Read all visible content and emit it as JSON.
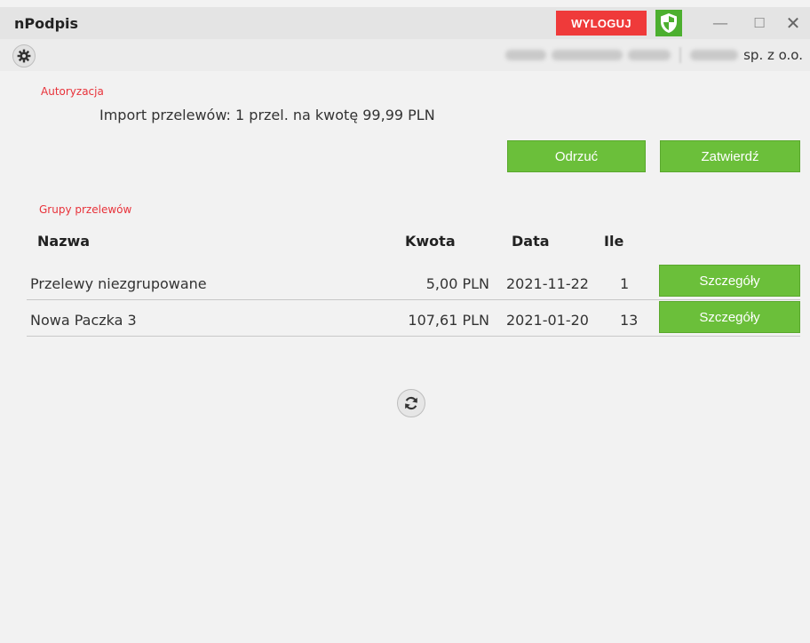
{
  "app": {
    "title": "nPodpis"
  },
  "titlebar": {
    "logout_label": "WYLOGUJ",
    "minimize_glyph": "—",
    "maximize_glyph": "☐",
    "close_glyph": "✕",
    "shield_icon": "shield-icon"
  },
  "toolbar": {
    "settings_icon": "gear-icon",
    "company_suffix": "sp. z o.o."
  },
  "authorization": {
    "section_label": "Autoryzacja",
    "import_text": "Import przelewów: 1 przel. na kwotę 99,99 PLN",
    "reject_label": "Odrzuć",
    "approve_label": "Zatwierdź"
  },
  "groups": {
    "section_label": "Grupy przelewów",
    "columns": {
      "name": "Nazwa",
      "amount": "Kwota",
      "date": "Data",
      "count": "Ile"
    },
    "rows": [
      {
        "name": "Przelewy niezgrupowane",
        "amount": "5,00 PLN",
        "date": "2021-11-22",
        "count": "1",
        "action": "Szczegóły"
      },
      {
        "name": "Nowa Paczka 3",
        "amount": "107,61 PLN",
        "date": "2021-01-20",
        "count": "13",
        "action": "Szczegóły"
      }
    ]
  },
  "refresh": {
    "icon": "refresh-icon"
  },
  "colors": {
    "accent_green": "#6bbf3a",
    "logout_red": "#ef3a3a",
    "label_red": "#e8323a",
    "shield_green": "#4caf2f"
  }
}
